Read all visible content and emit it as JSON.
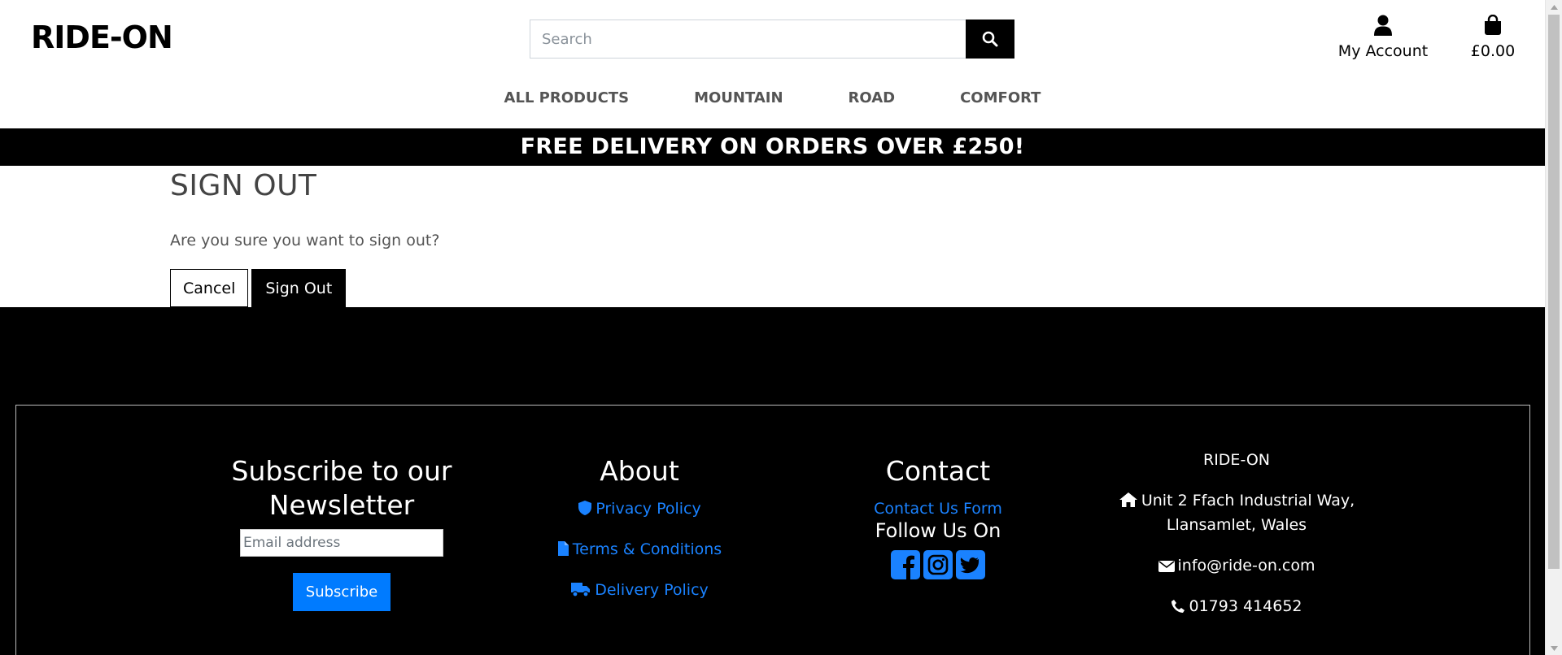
{
  "header": {
    "logo": "RIDE-ON",
    "search_placeholder": "Search",
    "account_label": "My Account",
    "bag_total": "£0.00",
    "icons": {
      "search": "search-icon",
      "account": "user-icon",
      "bag": "shopping-bag-icon"
    }
  },
  "nav": {
    "items": [
      {
        "label": "ALL PRODUCTS"
      },
      {
        "label": "MOUNTAIN"
      },
      {
        "label": "ROAD"
      },
      {
        "label": "COMFORT"
      }
    ]
  },
  "banner": {
    "text": "FREE DELIVERY ON ORDERS OVER £250!"
  },
  "main": {
    "title": "SIGN OUT",
    "question": "Are you sure you want to sign out?",
    "cancel_label": "Cancel",
    "signout_label": "Sign Out"
  },
  "footer": {
    "newsletter": {
      "heading_line1": "Subscribe to our",
      "heading_line2": "Newsletter",
      "email_placeholder": "Email address",
      "subscribe_label": "Subscribe"
    },
    "about": {
      "heading": "About",
      "links": [
        {
          "label": "Privacy Policy",
          "icon": "shield-icon"
        },
        {
          "label": "Terms & Conditions",
          "icon": "file-icon"
        },
        {
          "label": "Delivery Policy",
          "icon": "truck-icon"
        }
      ]
    },
    "contact": {
      "heading": "Contact",
      "form_link": "Contact Us Form",
      "follow": "Follow Us On",
      "socials": [
        "facebook-icon",
        "instagram-icon",
        "twitter-icon"
      ]
    },
    "info": {
      "name": "RIDE-ON",
      "address_line1": "Unit 2 Ffach Industrial Way,",
      "address_line2": "Llansamlet, Wales",
      "email": "info@ride-on.com",
      "phone": "01793 414652"
    }
  },
  "colors": {
    "accent": "#007bff",
    "link": "#1a82ff",
    "dark": "#000000",
    "muted": "#555555"
  }
}
